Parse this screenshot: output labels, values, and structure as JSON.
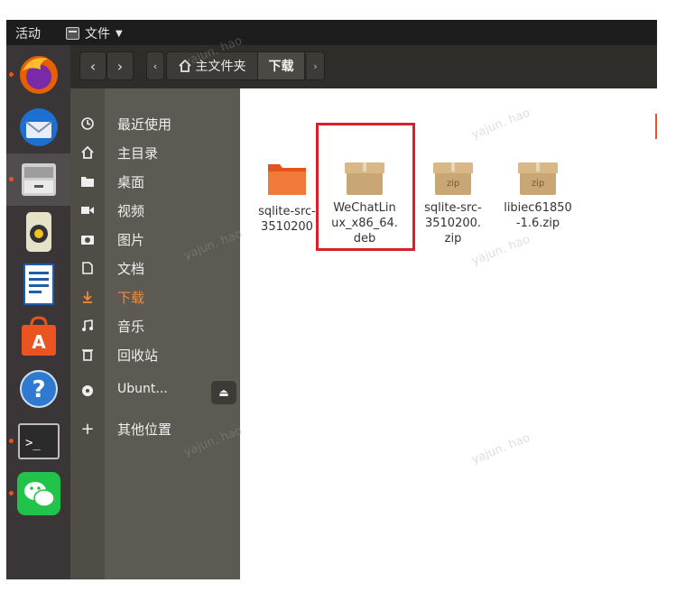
{
  "topbar": {
    "activities": "活动",
    "app_menu": "文件"
  },
  "dock": {
    "apps": [
      {
        "name": "firefox-icon"
      },
      {
        "name": "thunderbird-icon"
      },
      {
        "name": "files-icon"
      },
      {
        "name": "rhythmbox-icon"
      },
      {
        "name": "writer-icon"
      },
      {
        "name": "software-icon"
      },
      {
        "name": "help-icon"
      },
      {
        "name": "terminal-icon"
      },
      {
        "name": "wechat-icon"
      }
    ],
    "help_glyph": "?",
    "terminal_glyph": ">_"
  },
  "header": {
    "back": "‹",
    "forward": "›",
    "path_prev": "‹",
    "home_label": "主文件夹",
    "current_label": "下载",
    "path_next": "›"
  },
  "sidebar": {
    "items": [
      {
        "label": "最近使用"
      },
      {
        "label": "主目录"
      },
      {
        "label": "桌面"
      },
      {
        "label": "视频"
      },
      {
        "label": "图片"
      },
      {
        "label": "文档"
      },
      {
        "label": "下载"
      },
      {
        "label": "音乐"
      },
      {
        "label": "回收站"
      },
      {
        "label": "Ubunt..."
      },
      {
        "label": "其他位置"
      }
    ],
    "eject_glyph": "⏏",
    "add_glyph": "+"
  },
  "files": [
    {
      "name": "sqlite-src-3510200",
      "line1": "sqlite-src-",
      "line2": "3510200",
      "line3": ""
    },
    {
      "name": "WeChatLinux_x86_64.deb",
      "line1": "WeChatLin",
      "line2": "ux_x86_64.",
      "line3": "deb"
    },
    {
      "name": "sqlite-src-3510200.zip",
      "line1": "sqlite-src-",
      "line2": "3510200.",
      "line3": "zip",
      "badge": "zip"
    },
    {
      "name": "libiec61850-1.6.zip",
      "line1": "libiec61850",
      "line2": "-1.6.zip",
      "line3": "",
      "badge": "zip"
    }
  ],
  "watermark": "yajun. hao",
  "colors": {
    "accent": "#e95420",
    "highlight": "#d9202a",
    "active_sidebar": "#f08a3c"
  }
}
